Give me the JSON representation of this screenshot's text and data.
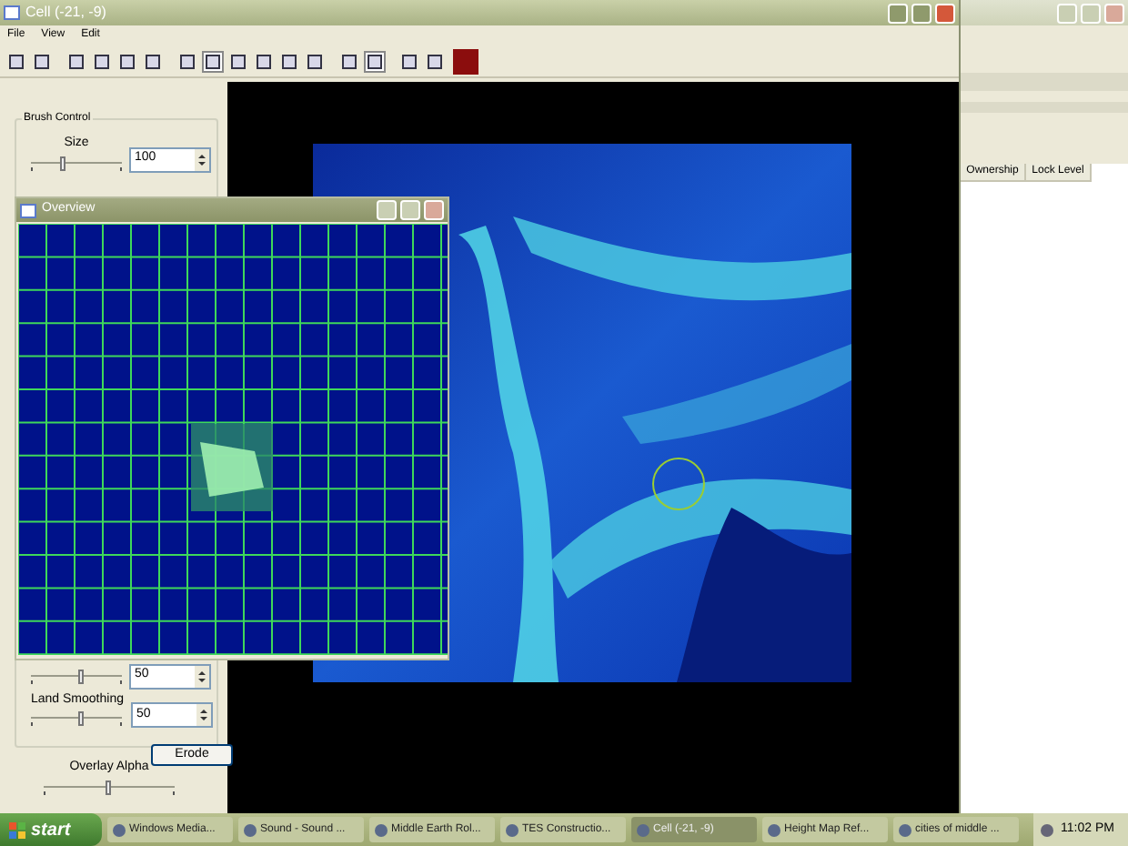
{
  "window": {
    "title": "Cell (-21, -9)"
  },
  "menu": [
    "File",
    "View",
    "Edit"
  ],
  "toolbar": [
    {
      "selected": false
    },
    {
      "selected": false
    },
    {
      "selected": false
    },
    {
      "selected": false
    },
    {
      "selected": false
    },
    {
      "selected": false
    },
    {
      "selected": false
    },
    {
      "selected": true
    },
    {
      "selected": false
    },
    {
      "selected": false
    },
    {
      "selected": false
    },
    {
      "selected": false
    },
    {
      "selected": false
    },
    {
      "selected": true
    },
    {
      "selected": false
    },
    {
      "selected": false
    }
  ],
  "brush_control": {
    "title": "Brush Control",
    "size": {
      "label": "Size",
      "level": 0.35,
      "value": "100"
    }
  },
  "strength": {
    "level": 0.55,
    "value": "50"
  },
  "land_smoothing": {
    "label": "Land Smoothing",
    "level": 0.55,
    "value": "50"
  },
  "erode_button": "Erode",
  "overlay_alpha": {
    "label": "Overlay Alpha",
    "level": 0.5
  },
  "overview": {
    "title": "Overview"
  },
  "background_window": {
    "columns": [
      "Ownership",
      "Lock Level"
    ]
  },
  "taskbar": {
    "start": "start",
    "items": [
      {
        "label": "Windows Media...",
        "selected": false
      },
      {
        "label": "Sound - Sound ...",
        "selected": false
      },
      {
        "label": "Middle Earth Rol...",
        "selected": false
      },
      {
        "label": "TES Constructio...",
        "selected": false
      },
      {
        "label": "Cell (-21, -9)",
        "selected": true
      },
      {
        "label": "Height Map Ref...",
        "selected": false
      },
      {
        "label": "cities of middle ...",
        "selected": false
      }
    ],
    "clock": "11:02 PM"
  }
}
